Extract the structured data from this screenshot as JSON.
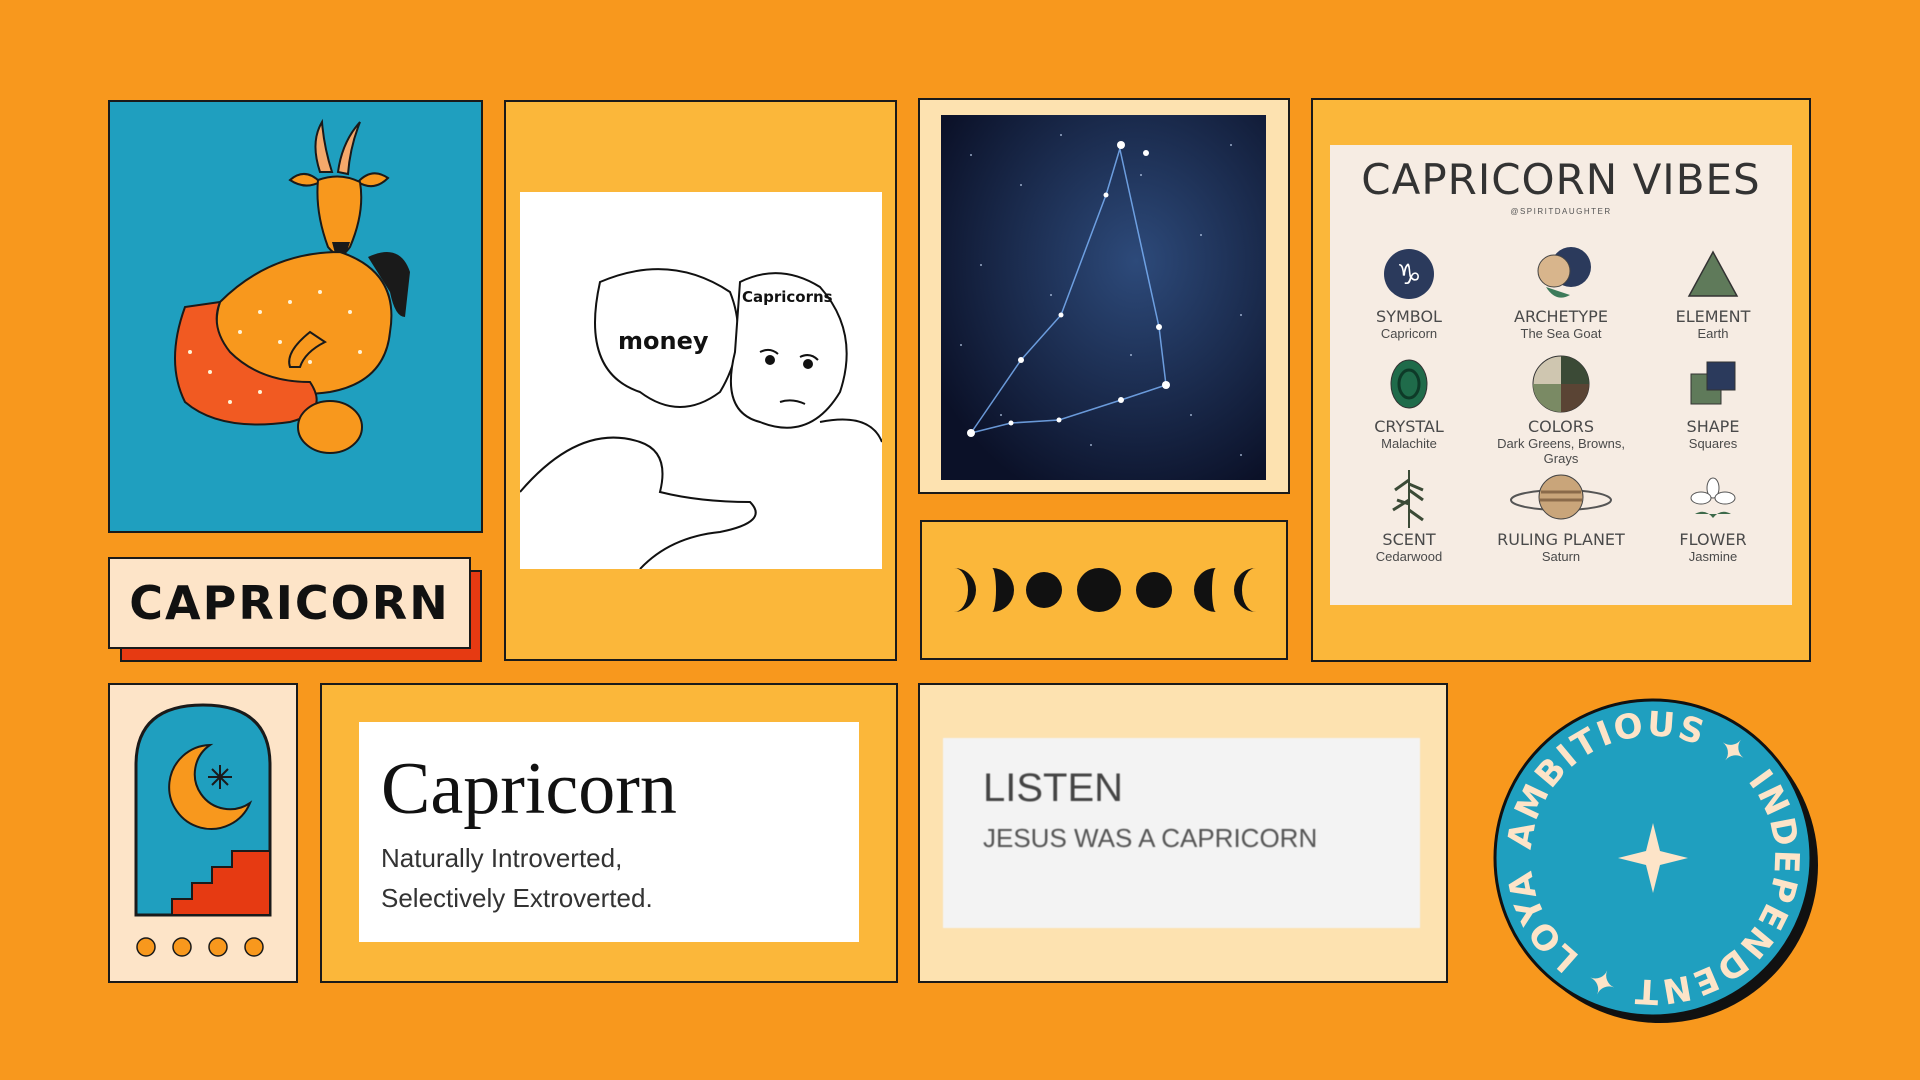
{
  "label": {
    "text": "CAPRICORN"
  },
  "meme": {
    "left_label": "money",
    "right_label": "Capricorns"
  },
  "vibes": {
    "title": "CAPRICORN VIBES",
    "handle": "@SPIRITDAUGHTER",
    "items": [
      {
        "name": "SYMBOL",
        "value": "Capricorn",
        "icon": "capricorn-symbol-icon"
      },
      {
        "name": "ARCHETYPE",
        "value": "The Sea Goat",
        "icon": "sea-goat-icon"
      },
      {
        "name": "ELEMENT",
        "value": "Earth",
        "icon": "triangle-icon"
      },
      {
        "name": "CRYSTAL",
        "value": "Malachite",
        "icon": "crystal-icon"
      },
      {
        "name": "COLORS",
        "value": "Dark Greens, Browns, Grays",
        "icon": "color-wheel-icon"
      },
      {
        "name": "SHAPE",
        "value": "Squares",
        "icon": "squares-icon"
      },
      {
        "name": "SCENT",
        "value": "Cedarwood",
        "icon": "cedar-branch-icon"
      },
      {
        "name": "RULING PLANET",
        "value": "Saturn",
        "icon": "saturn-icon"
      },
      {
        "name": "FLOWER",
        "value": "Jasmine",
        "icon": "jasmine-icon"
      }
    ]
  },
  "definition": {
    "title": "Capricorn",
    "line1": "Naturally Introverted,",
    "line2": "Selectively Extroverted."
  },
  "listen": {
    "title": "LISTEN",
    "subtitle": "JESUS WAS A CAPRICORN"
  },
  "badge": {
    "words": [
      "INDEPENDENT",
      "LOYAL",
      "AMBITIOUS"
    ]
  },
  "colors": {
    "background": "#f8981d",
    "teal": "#1f9fbf",
    "red_orange": "#e63a12",
    "cream": "#fde4c8",
    "mustard": "#fbb73a"
  }
}
